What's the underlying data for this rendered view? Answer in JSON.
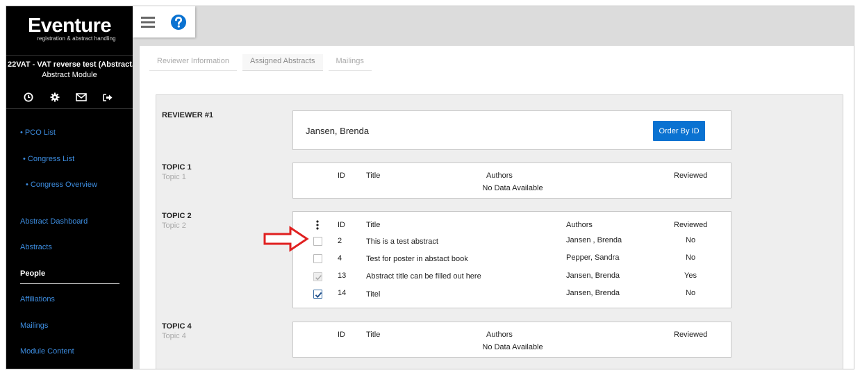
{
  "sidebar": {
    "brand": "Eventure",
    "tagline": "registration & abstract handling",
    "congress_name": "22VAT - VAT reverse test (Abstract...",
    "module_name": "Abstract Module",
    "tool_icons": [
      "clock-icon",
      "gear-icon",
      "envelope-icon",
      "sign-out-icon"
    ],
    "nav": {
      "pco_list": "• PCO List",
      "congress_list": "• Congress List",
      "congress_overview": "• Congress Overview",
      "abstract_dashboard": "Abstract Dashboard",
      "abstracts": "Abstracts",
      "people": "People",
      "affiliations": "Affiliations",
      "mailings": "Mailings",
      "module_content": "Module Content"
    }
  },
  "topbar": {
    "menu_icon": "hamburger-icon",
    "help_icon": "help-icon"
  },
  "tabs": {
    "reviewer_information": "Reviewer Information",
    "assigned_abstracts": "Assigned Abstracts",
    "mailings": "Mailings"
  },
  "reviewer": {
    "label": "REVIEWER #1",
    "name": "Jansen, Brenda",
    "order_button": "Order By ID"
  },
  "columns": {
    "id": "ID",
    "title": "Title",
    "authors": "Authors",
    "reviewed": "Reviewed"
  },
  "topics": {
    "topic1": {
      "label": "TOPIC 1",
      "sub": "Topic 1",
      "empty": "No Data Available"
    },
    "topic2": {
      "label": "TOPIC 2",
      "sub": "Topic 2",
      "rows": [
        {
          "id": "2",
          "title": "This is a test abstract",
          "authors": "Jansen , Brenda",
          "reviewed": "No",
          "checkbox": "unchecked"
        },
        {
          "id": "4",
          "title": "Test for poster in abstact book",
          "authors": "Pepper, Sandra",
          "reviewed": "No",
          "checkbox": "unchecked"
        },
        {
          "id": "13",
          "title": "Abstract title can be filled out here",
          "authors": "Jansen, Brenda",
          "reviewed": "Yes",
          "checkbox": "disabled-checked"
        },
        {
          "id": "14",
          "title": "Titel",
          "authors": "Jansen, Brenda",
          "reviewed": "No",
          "checkbox": "checked"
        }
      ]
    },
    "topic4": {
      "label": "TOPIC 4",
      "sub": "Topic 4",
      "empty": "No Data Available"
    }
  },
  "colors": {
    "accent": "#0a72d1",
    "link": "#3d8de0",
    "arrow": "#e02020"
  }
}
